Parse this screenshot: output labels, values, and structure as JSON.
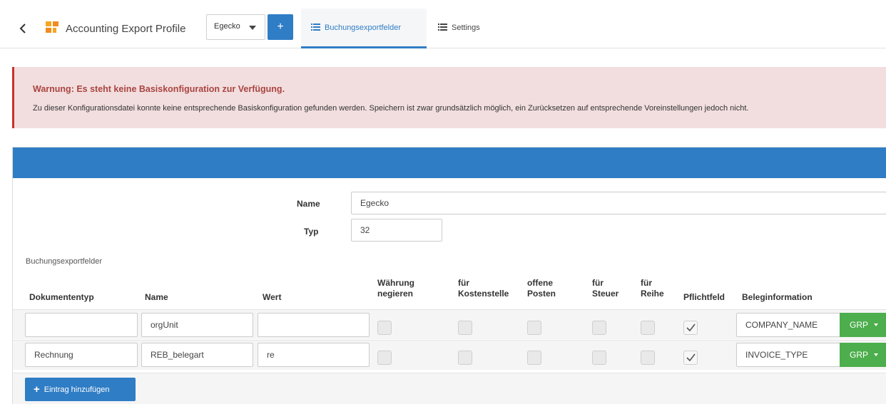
{
  "header": {
    "app_title": "Accounting Export Profile",
    "profile_select_value": "Egecko",
    "add_profile_label": "+",
    "tabs": [
      {
        "label": "Buchungsexportfelder",
        "active": true
      },
      {
        "label": "Settings",
        "active": false
      }
    ]
  },
  "alert": {
    "title": "Warnung: Es steht keine Basiskonfiguration zur Verfügung.",
    "text": "Zu dieser Konfigurationsdatei konnte keine entsprechende Basiskonfiguration gefunden werden. Speichern ist zwar grundsätzlich möglich, ein Zurücksetzen auf entsprechende Voreinstellungen jedoch nicht."
  },
  "form": {
    "name_label": "Name",
    "name_value": "Egecko",
    "typ_label": "Typ",
    "typ_value": "32"
  },
  "table": {
    "section_label": "Buchungsexportfelder",
    "columns": {
      "dokumententyp": "Dokumententyp",
      "name": "Name",
      "wert": "Wert",
      "waehrung_1": "Währung",
      "waehrung_2": "negieren",
      "kostenstelle_1": "für",
      "kostenstelle_2": "Kostenstelle",
      "offene_1": "offene",
      "offene_2": "Posten",
      "steuer_1": "für",
      "steuer_2": "Steuer",
      "reihe_1": "für",
      "reihe_2": "Reihe",
      "pflichtfeld": "Pflichtfeld",
      "beleginformation": "Beleginformation"
    },
    "rows": [
      {
        "dokumententyp": "",
        "name": "orgUnit",
        "wert": "",
        "waehrung_negieren": false,
        "fuer_kostenstelle": false,
        "offene_posten": false,
        "fuer_steuer": false,
        "fuer_reihe": false,
        "pflichtfeld": true,
        "beleginformation": "COMPANY_NAME",
        "grp_label": "GRP"
      },
      {
        "dokumententyp": "Rechnung",
        "name": "REB_belegart",
        "wert": "re",
        "waehrung_negieren": false,
        "fuer_kostenstelle": false,
        "offene_posten": false,
        "fuer_steuer": false,
        "fuer_reihe": false,
        "pflichtfeld": true,
        "beleginformation": "INVOICE_TYPE",
        "grp_label": "GRP"
      }
    ],
    "add_entry_label": "Eintrag hinzufügen",
    "add_entry_icon": "+"
  },
  "colors": {
    "primary": "#2f7dc5",
    "danger_bg": "#f2dede",
    "danger_text": "#a94442",
    "success": "#4cae4c"
  },
  "icons": [
    "chevron-left-icon",
    "app-logo-icon",
    "caret-down-icon",
    "plus-icon",
    "list-icon",
    "checkmark-icon"
  ]
}
